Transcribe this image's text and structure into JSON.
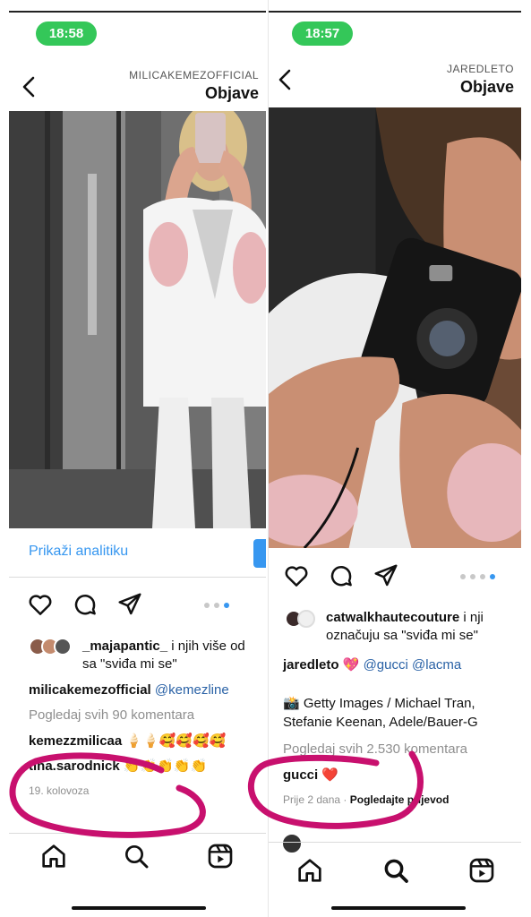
{
  "left": {
    "status_time": "18:58",
    "header": {
      "username": "MILICAKEMEZOFFICIAL",
      "title": "Objave"
    },
    "analytics_label": "Prikaži analitiku",
    "liked_by": {
      "name": "_majapantic_",
      "rest1": " i njih više od",
      "line2": "sa \"sviđa mi se\""
    },
    "caption": {
      "username": "milicakemezofficial",
      "mention": "@kemezline"
    },
    "view_comments": "Pogledaj svih 90 komentara",
    "comments": [
      {
        "username": "kemezzmilicaa",
        "text": "🍦🍦🥰🥰🥰🥰"
      },
      {
        "username": "tina.sarodnick",
        "text": "👏👏👏👏👏"
      }
    ],
    "date": "19. kolovoza"
  },
  "right": {
    "status_time": "18:57",
    "header": {
      "username": "JAREDLETO",
      "title": "Objave"
    },
    "tagged": {
      "name": "catwalkhautecouture",
      "rest1": " i nji",
      "line2": "označuju sa \"sviđa mi se\""
    },
    "caption": {
      "username": "jaredleto",
      "emoji": "💖",
      "mention1": "@gucci",
      "mention2": "@lacma"
    },
    "credits": {
      "line1": "📸 Getty Images / Michael Tran,",
      "line2": "Stefanie Keenan, Adele/Bauer-G"
    },
    "view_comments": "Pogledaj svih 2.530 komentara",
    "comment": {
      "username": "gucci",
      "text": "❤️"
    },
    "time_ago": "Prije 2 dana",
    "separator": "·",
    "translate": "Pogledajte prijevod"
  },
  "colors": {
    "accent": "#3797f0",
    "marker": "#c8106e",
    "time_pill": "#34c759"
  },
  "icons": [
    "back-arrow-icon",
    "heart-icon",
    "comment-icon",
    "share-icon",
    "home-icon",
    "search-icon",
    "reels-icon"
  ]
}
